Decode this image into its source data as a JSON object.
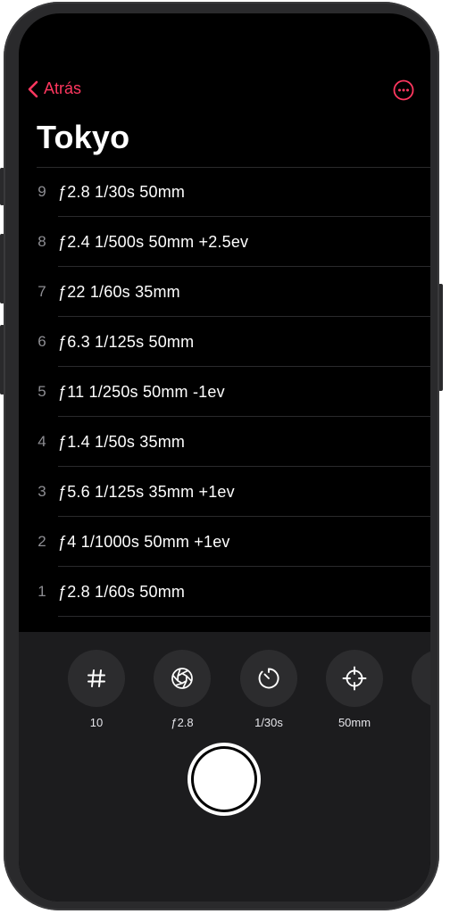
{
  "nav": {
    "back_label": "Atrás"
  },
  "title": "Tokyo",
  "shots": [
    {
      "num": "9",
      "settings": "ƒ2.8  1/30s  50mm"
    },
    {
      "num": "8",
      "settings": "ƒ2.4  1/500s  50mm  +2.5ev"
    },
    {
      "num": "7",
      "settings": "ƒ22  1/60s  35mm"
    },
    {
      "num": "6",
      "settings": "ƒ6.3  1/125s  50mm"
    },
    {
      "num": "5",
      "settings": "ƒ11  1/250s  50mm  -1ev"
    },
    {
      "num": "4",
      "settings": "ƒ1.4  1/50s  35mm"
    },
    {
      "num": "3",
      "settings": "ƒ5.6  1/125s  35mm  +1ev"
    },
    {
      "num": "2",
      "settings": "ƒ4  1/1000s  50mm  +1ev"
    },
    {
      "num": "1",
      "settings": "ƒ2.8  1/60s  50mm"
    }
  ],
  "controls": [
    {
      "icon": "hash-icon",
      "label": "10"
    },
    {
      "icon": "aperture-icon",
      "label": "ƒ2.8"
    },
    {
      "icon": "timer-icon",
      "label": "1/30s"
    },
    {
      "icon": "crosshair-icon",
      "label": "50mm"
    }
  ],
  "colors": {
    "accent": "#ff375f",
    "background": "#000000",
    "panel": "#1c1c1e"
  }
}
